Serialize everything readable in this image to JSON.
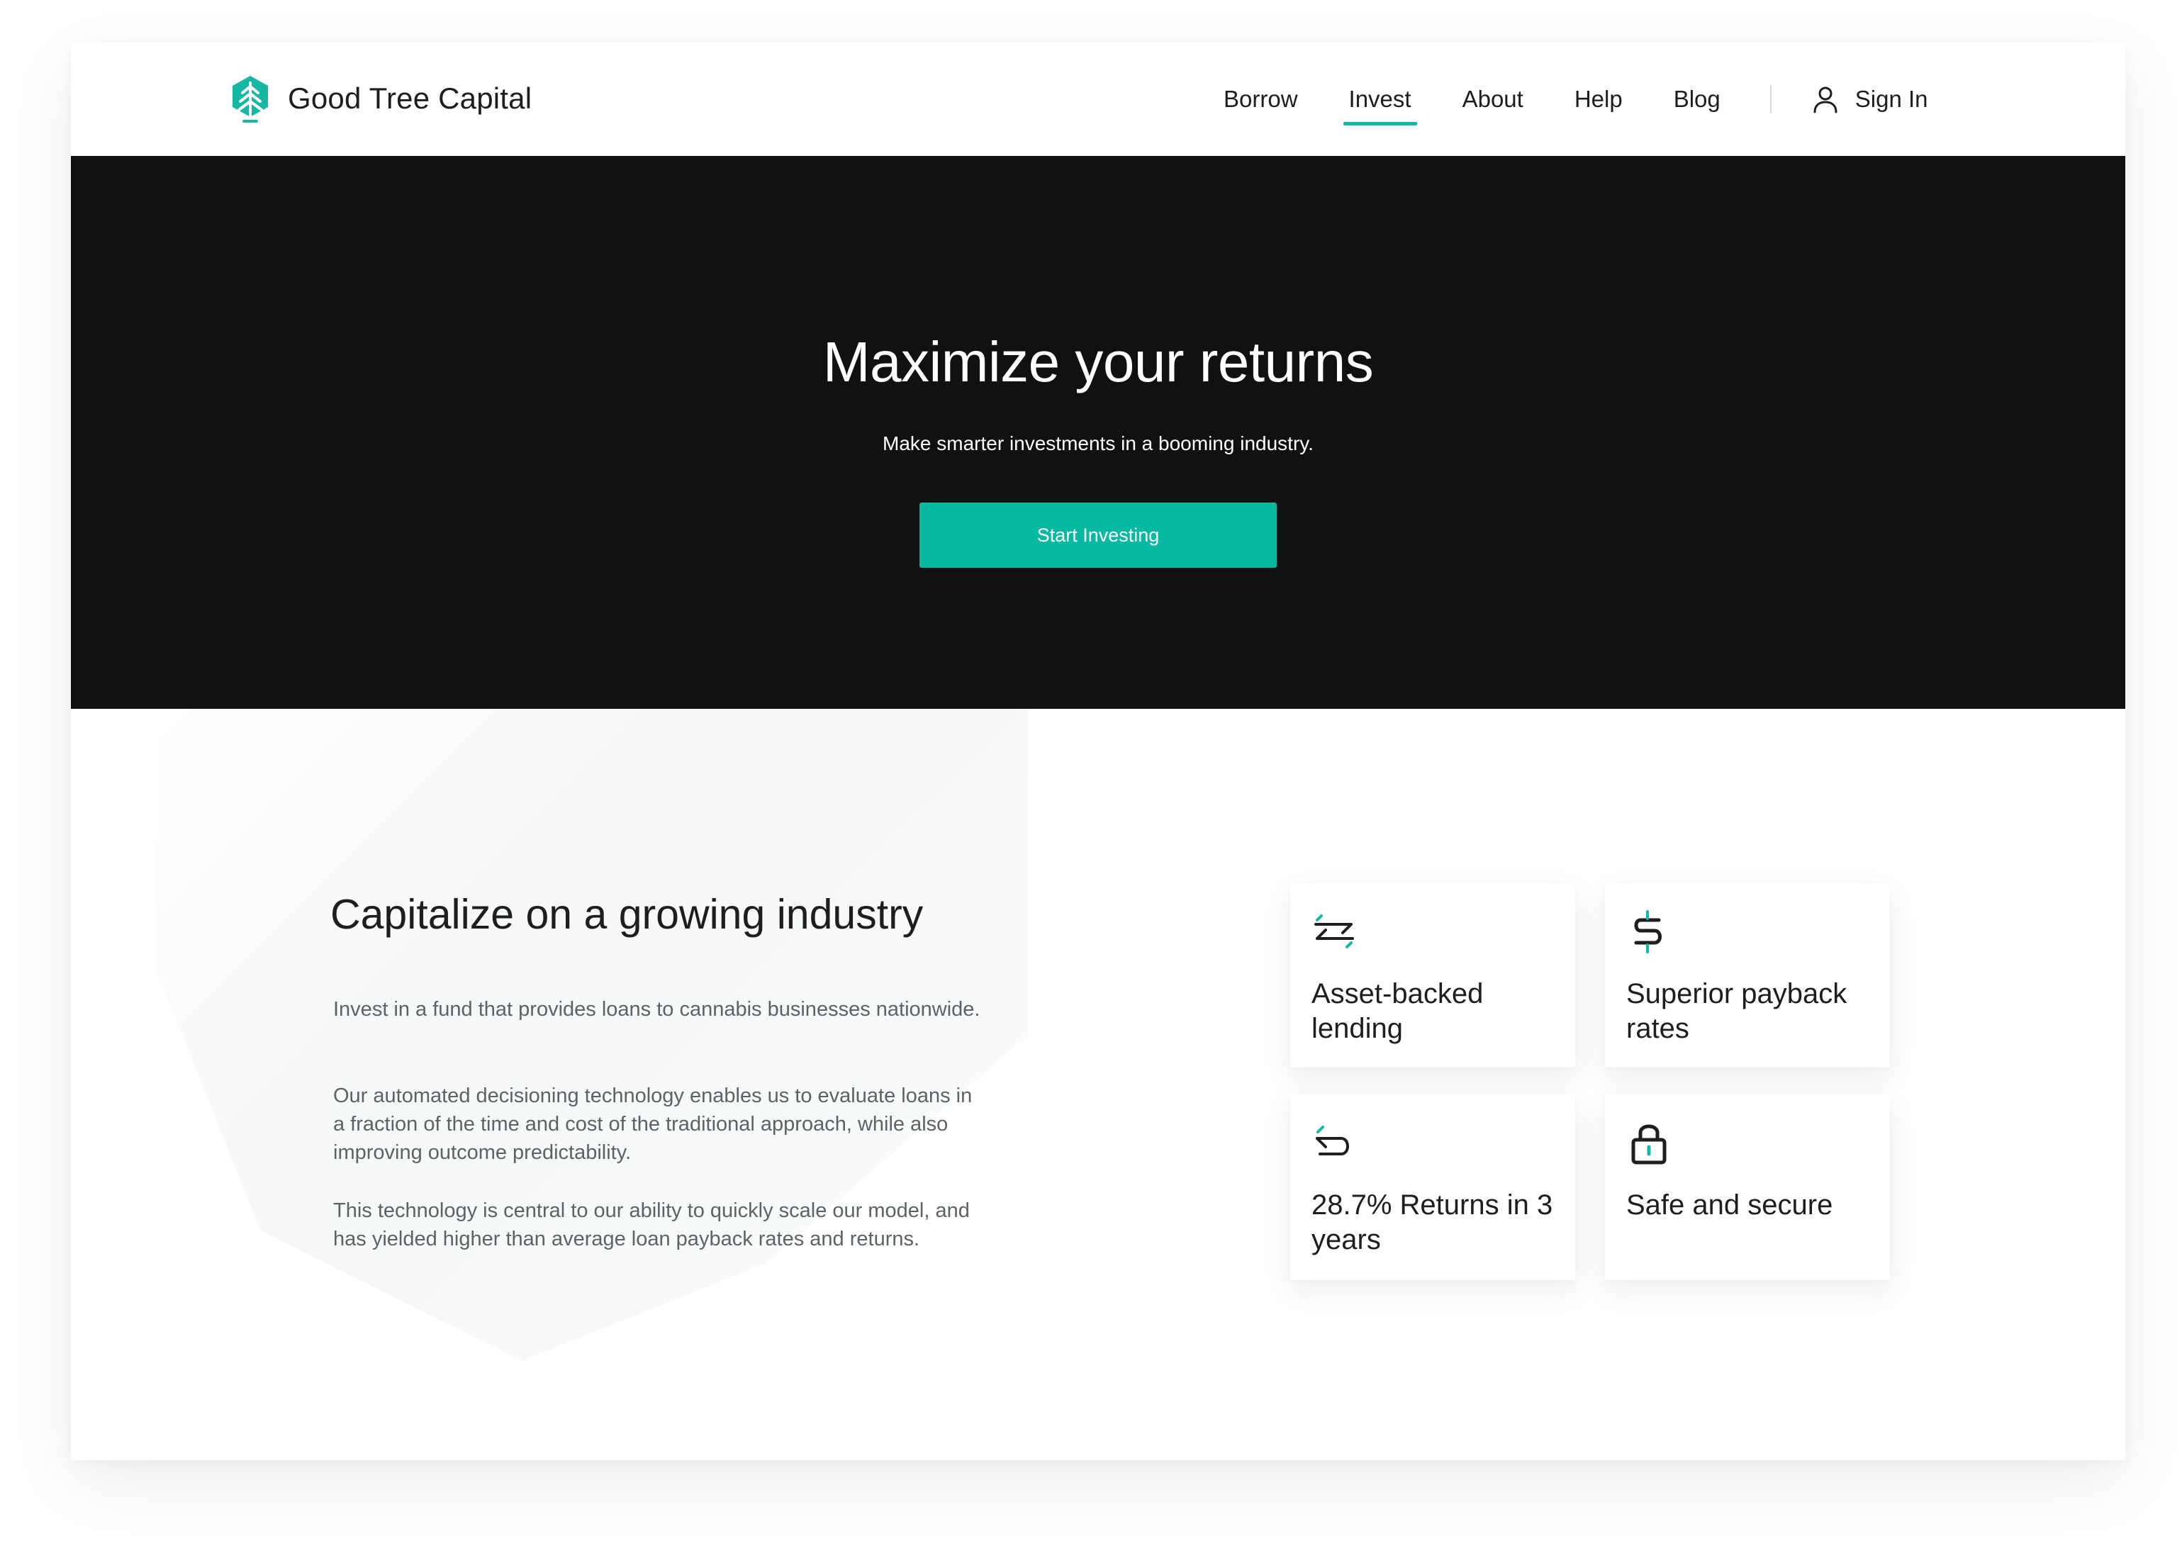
{
  "brand": {
    "name": "Good Tree Capital",
    "accent": "#15b8a3",
    "dark": "#101212"
  },
  "nav": {
    "links": [
      {
        "label": "Borrow",
        "active": false
      },
      {
        "label": "Invest",
        "active": true
      },
      {
        "label": "About",
        "active": false
      },
      {
        "label": "Help",
        "active": false
      },
      {
        "label": "Blog",
        "active": false
      }
    ],
    "sign_in": {
      "label": "Sign In",
      "icon": "user-icon"
    }
  },
  "hero": {
    "title": "Maximize your returns",
    "subtitle": "Make smarter investments in a booming industry.",
    "cta": "Start Investing"
  },
  "section": {
    "title": "Capitalize on a growing industry",
    "paragraphs": [
      "Invest in a fund that provides loans to cannabis businesses nationwide.",
      "Our automated decisioning technology enables us to evaluate loans in a fraction of the time and cost of the traditional approach, while also improving outcome predictability.",
      "This technology is central to our ability to quickly scale our model, and has yielded higher than average loan payback rates and returns."
    ]
  },
  "features": [
    {
      "label": "Asset-backed lending",
      "icon": "exchange-arrows-icon"
    },
    {
      "label": "Superior payback rates",
      "icon": "dollar-icon"
    },
    {
      "label": "28.7% Returns in 3 years",
      "icon": "return-arrow-icon"
    },
    {
      "label": "Safe and secure",
      "icon": "lock-icon"
    }
  ]
}
